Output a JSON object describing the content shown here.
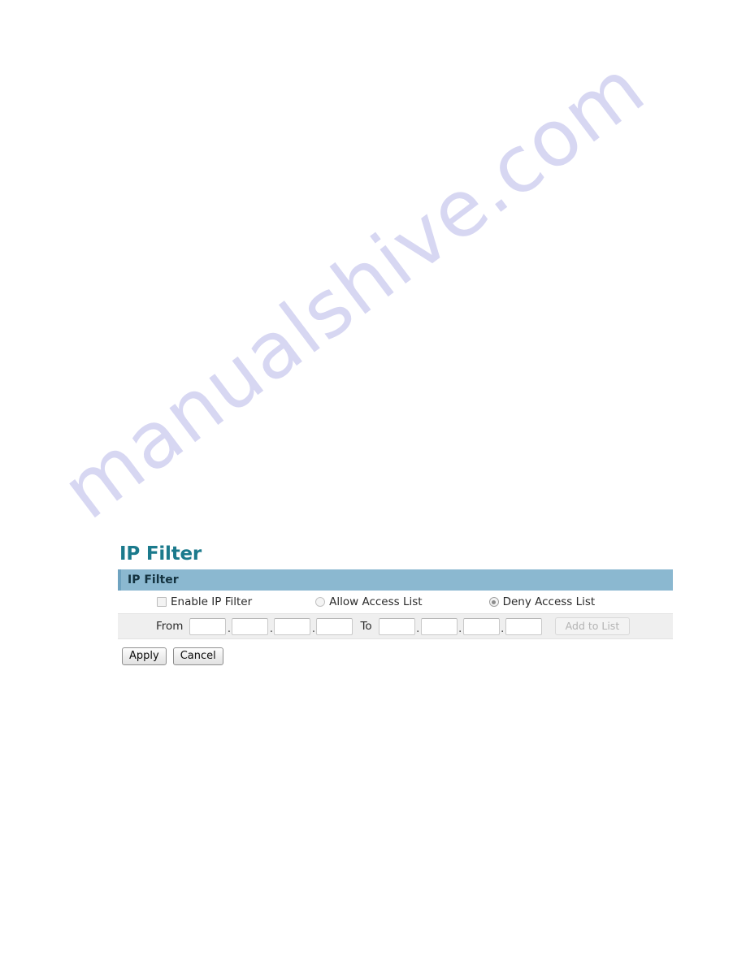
{
  "watermark": {
    "text": "manualshive.com",
    "color": "#d7d7f2"
  },
  "page": {
    "title": "IP Filter",
    "title_color": "#1b7a8c"
  },
  "panel": {
    "header_title": "IP Filter",
    "header_bg": "#8bb8d0",
    "header_accent": "#6fa3c0"
  },
  "options": {
    "enable_filter": {
      "label": "Enable IP Filter",
      "checked": false
    },
    "access_mode": {
      "allow": {
        "label": "Allow Access List",
        "selected": false
      },
      "deny": {
        "label": "Deny Access List",
        "selected": true
      }
    }
  },
  "range": {
    "from_label": "From",
    "to_label": "To",
    "separator": ".",
    "from_octets": [
      "",
      "",
      "",
      ""
    ],
    "to_octets": [
      "",
      "",
      "",
      ""
    ],
    "octet_placeholder": "",
    "add_button": {
      "label": "Add to List",
      "disabled": true
    }
  },
  "actions": {
    "apply_label": "Apply",
    "cancel_label": "Cancel"
  }
}
